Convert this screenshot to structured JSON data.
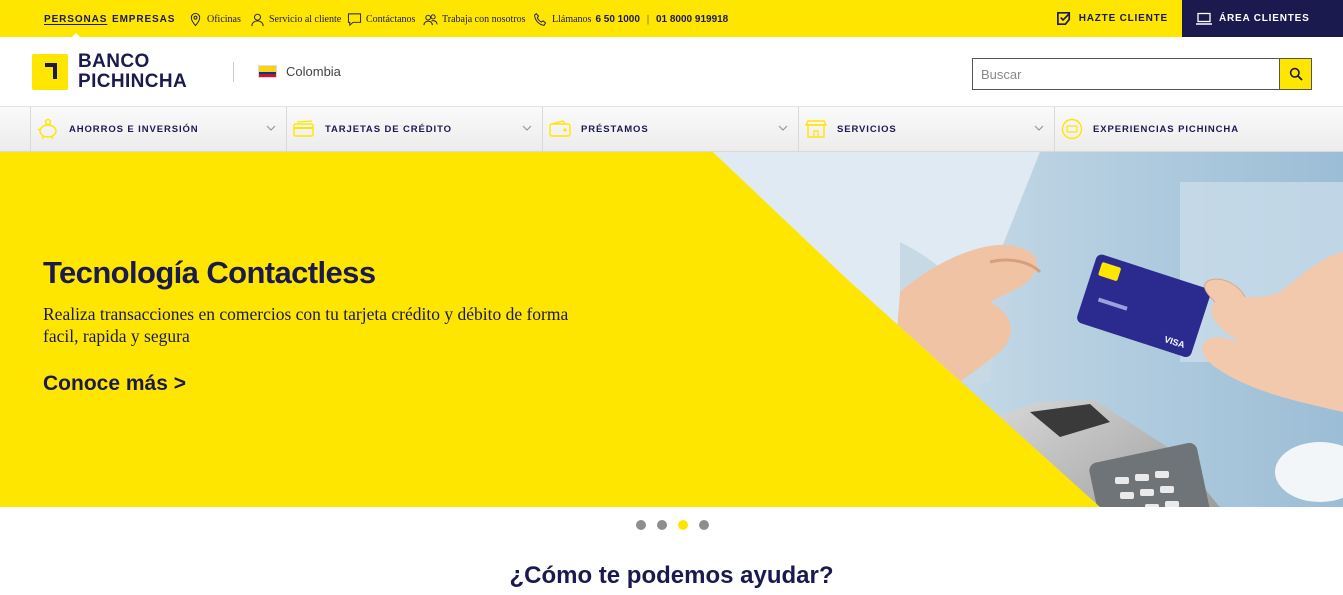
{
  "topbar": {
    "segments": [
      {
        "label": "PERSONAS",
        "active": true
      },
      {
        "label": "EMPRESAS",
        "active": false
      }
    ],
    "links": {
      "oficinas": "Oficinas",
      "servicio": "Servicio al cliente",
      "contactanos": "Contáctanos",
      "trabaja": "Trabaja con nosotros",
      "llamanos": "Llámanos",
      "phone_local": "6 50 1000",
      "phone_sep": "|",
      "phone_national": "01 8000 919918"
    },
    "hazte_cliente": "HAZTE CLIENTE",
    "area_clientes": "ÁREA CLIENTES",
    "colors": {
      "bar": "#ffe600",
      "area_bg": "#1b1a4f"
    }
  },
  "header": {
    "logo_line1": "BANCO",
    "logo_line2": "PICHINCHA",
    "country": "Colombia",
    "search_placeholder": "Buscar"
  },
  "nav": {
    "items": [
      {
        "label": "AHORROS E INVERSIÓN",
        "icon": "piggy-bank-icon",
        "has_dropdown": true
      },
      {
        "label": "TARJETAS DE CRÉDITO",
        "icon": "credit-card-icon",
        "has_dropdown": true
      },
      {
        "label": "PRÉSTAMOS",
        "icon": "wallet-icon",
        "has_dropdown": true
      },
      {
        "label": "SERVICIOS",
        "icon": "store-icon",
        "has_dropdown": true
      },
      {
        "label": "EXPERIENCIAS PICHINCHA",
        "icon": "ticket-icon",
        "has_dropdown": false
      }
    ]
  },
  "hero": {
    "title": "Tecnología Contactless",
    "subtitle": "Realiza transacciones en comercios  con tu tarjeta crédito y débito de forma facil, rapida y segura",
    "cta": "Conoce más >",
    "slides_total": 4,
    "active_slide": 3
  },
  "section": {
    "heading": "¿Cómo te podemos ayudar?"
  },
  "colors": {
    "brand_yellow": "#ffe600",
    "brand_navy": "#1b1a4f"
  }
}
